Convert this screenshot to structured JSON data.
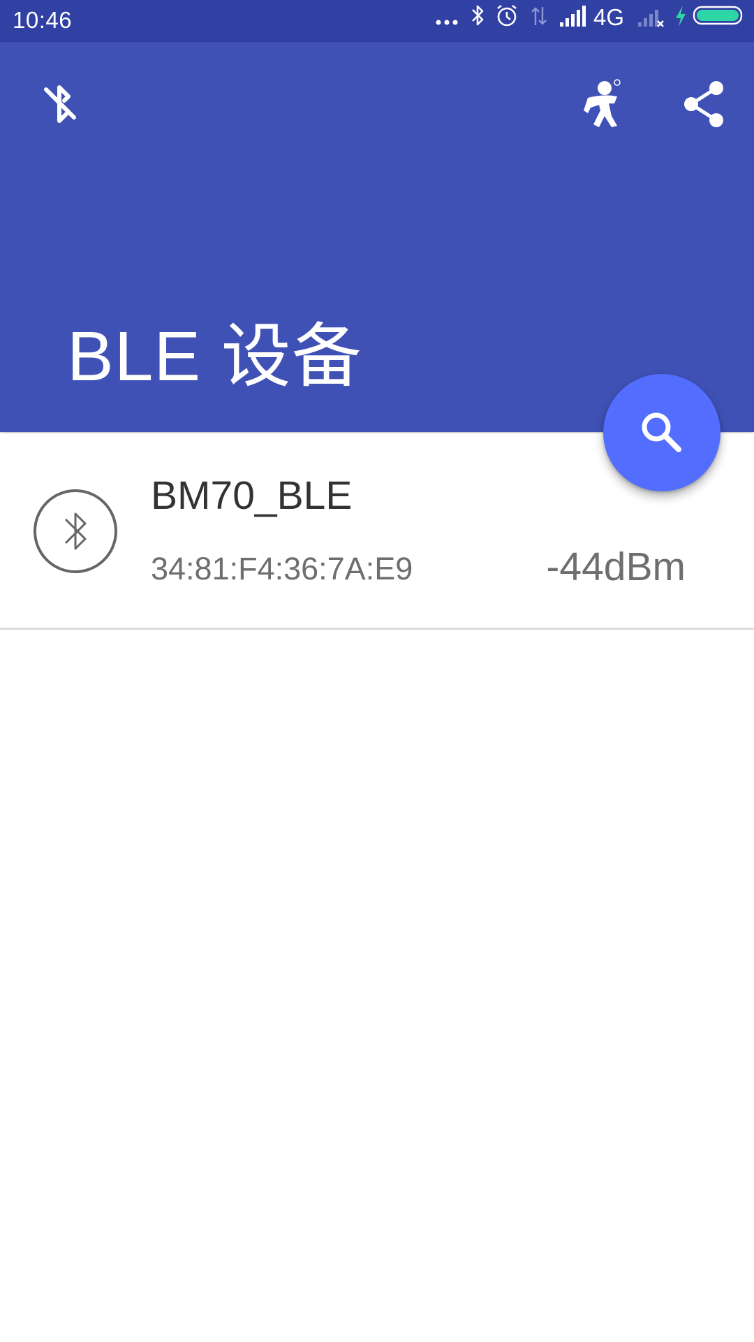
{
  "status_bar": {
    "time": "10:46",
    "network": "4G",
    "icons": [
      "more-dots-icon",
      "bluetooth-icon",
      "alarm-icon",
      "data-arrows-icon",
      "signal-icon",
      "signal-no-sim-icon",
      "charging-icon",
      "battery-icon"
    ]
  },
  "app_bar": {
    "title": "BLE 设备",
    "actions": [
      "bluetooth-disabled-icon",
      "person-icon",
      "share-icon"
    ],
    "color": "#3f51b5"
  },
  "fab": {
    "icon": "search-icon",
    "color": "#536dfe"
  },
  "devices": [
    {
      "name": "BM70_BLE",
      "address": "34:81:F4:36:7A:E9",
      "rssi": "-44dBm",
      "icon": "bluetooth-circle-icon"
    }
  ]
}
